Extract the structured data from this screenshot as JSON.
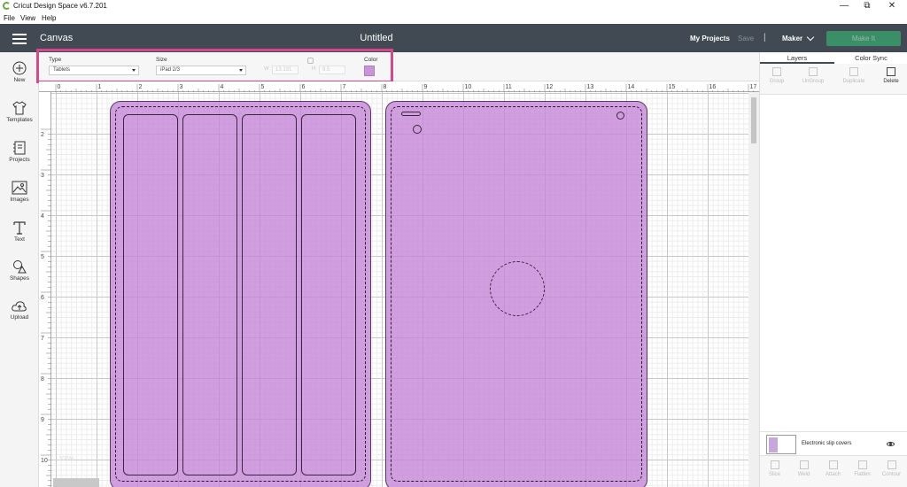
{
  "window": {
    "title": "Cricut Design Space  v6.7.201",
    "minimize_icon": "minimize-icon",
    "restore_icon": "restore-icon",
    "close_icon": "close-icon"
  },
  "menu": {
    "items": [
      "File",
      "View",
      "Help"
    ]
  },
  "header": {
    "section": "Canvas",
    "doc_title": "Untitled",
    "my_projects": "My Projects",
    "save": "Save",
    "separator": "|",
    "machine": "Maker",
    "make_it": "Make It"
  },
  "leftbar": {
    "tools": [
      {
        "label": "New",
        "icon": "plus-circle-icon"
      },
      {
        "label": "Templates",
        "icon": "shirt-icon"
      },
      {
        "label": "Projects",
        "icon": "projects-icon"
      },
      {
        "label": "Images",
        "icon": "image-icon"
      },
      {
        "label": "Text",
        "icon": "text-icon"
      },
      {
        "label": "Shapes",
        "icon": "shapes-icon"
      },
      {
        "label": "Upload",
        "icon": "upload-icon"
      }
    ]
  },
  "editbar": {
    "type_label": "Type",
    "type_value": "Tablets",
    "size_label": "Size",
    "size_value": "iPad 2/3",
    "w_label": "W",
    "w_value": "13.131",
    "h_label": "H",
    "h_value": "9.5",
    "color_label": "Color",
    "color_value": "#c896d6"
  },
  "rulers": {
    "top": [
      "0",
      "1",
      "2",
      "3",
      "4",
      "5",
      "6",
      "7",
      "8",
      "9",
      "10",
      "11",
      "12",
      "13",
      "14",
      "15",
      "16",
      "17"
    ],
    "left": [
      "2",
      "3",
      "4",
      "5",
      "6",
      "7",
      "8",
      "9",
      "10"
    ]
  },
  "canvas": {
    "zoom": "100%"
  },
  "rightpanel": {
    "tabs": [
      "Layers",
      "Color Sync"
    ],
    "top_tools": [
      "Group",
      "UnGroup",
      "Duplicate",
      "Delete"
    ],
    "layer_name": "Electronic slip covers",
    "bottom_tools": [
      "Slice",
      "Weld",
      "Attach",
      "Flatten",
      "Contour"
    ]
  }
}
